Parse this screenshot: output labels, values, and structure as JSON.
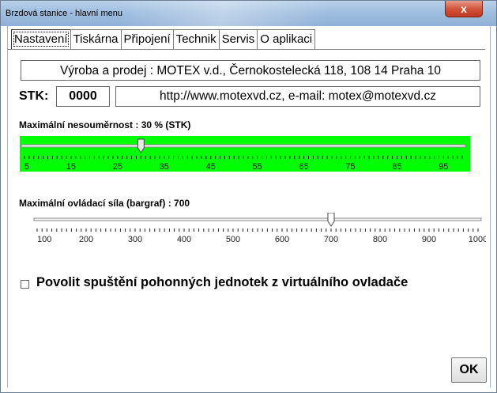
{
  "window": {
    "title": "Brzdová stanice - hlavní menu",
    "close_label": "x"
  },
  "tabs": [
    {
      "label": "Nastavení",
      "active": true
    },
    {
      "label": "Tiskárna",
      "active": false
    },
    {
      "label": "Připojení",
      "active": false
    },
    {
      "label": "Technik",
      "active": false
    },
    {
      "label": "Servis",
      "active": false
    },
    {
      "label": "O aplikaci",
      "active": false
    }
  ],
  "address": "Výroba a prodej : MOTEX v.d., Černokostelecká 118, 108 14  Praha 10",
  "stk": {
    "label": "STK:",
    "value": "0000"
  },
  "web_contact": "http://www.motexvd.cz, e-mail: motex@motexvd.cz",
  "slider_asymmetry": {
    "label": "Maximální nesouměrnost : 30 % (STK)",
    "min": 5,
    "max": 99,
    "value": 30,
    "tick_labels": [
      "5",
      "15",
      "25",
      "35",
      "45",
      "55",
      "65",
      "75",
      "85",
      "95"
    ],
    "background": "#00ff00"
  },
  "slider_force": {
    "label": "Maximální ovládací síla (bargraf) : 700",
    "min": 100,
    "max": 1000,
    "value": 700,
    "tick_labels": [
      "100",
      "200",
      "300",
      "400",
      "500",
      "600",
      "700",
      "800",
      "900",
      "1000"
    ],
    "background": "#ffffff"
  },
  "checkbox": {
    "label": "Povolit spuštění pohonných jednotek z virtuálního ovladače",
    "checked": false
  },
  "ok_button": "OK"
}
